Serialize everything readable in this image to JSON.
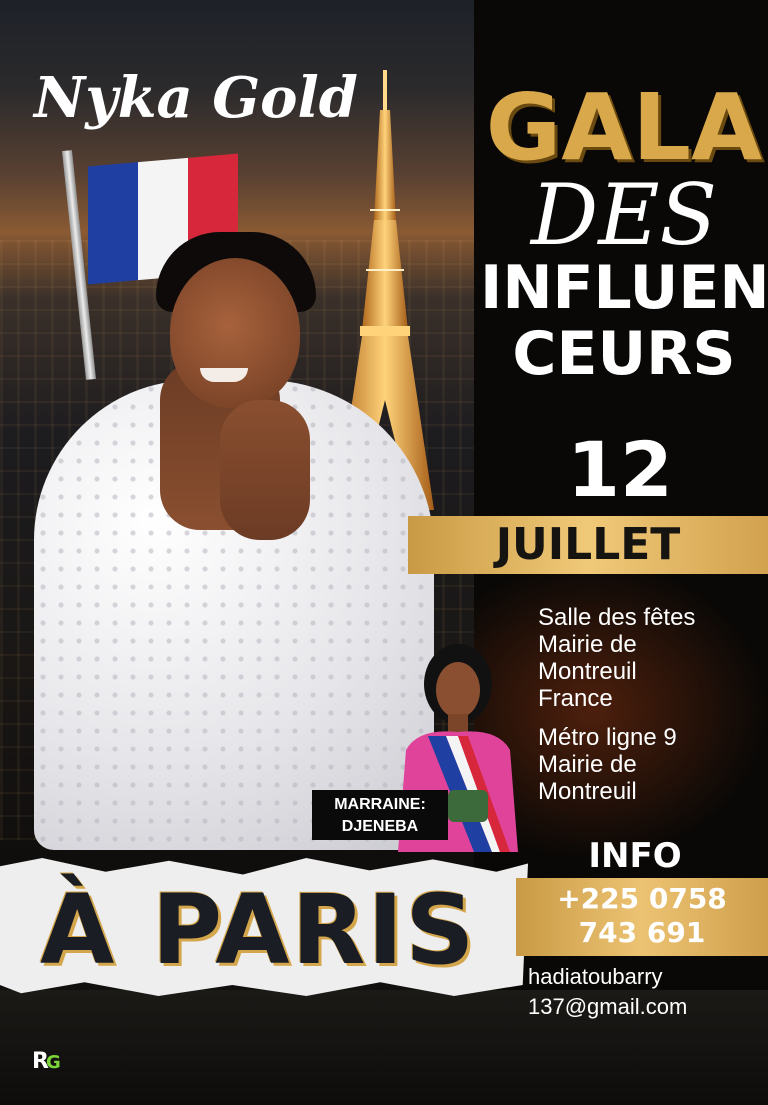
{
  "brand": "Nyka Gold",
  "title": {
    "line1": "GALA",
    "line2": "DES",
    "line3": "INFLUEN",
    "line4": "CEURS"
  },
  "date": {
    "day": "12",
    "month": "JUILLET"
  },
  "venue": {
    "line1": "Salle des fêtes",
    "line2": "Mairie de",
    "line3": "Montreuil",
    "line4": "France"
  },
  "metro": {
    "line1": "Métro ligne  9",
    "line2": "Mairie de",
    "line3": "Montreuil"
  },
  "marraine": {
    "label": "MARRAINE:",
    "name": "DJENEBA"
  },
  "info": {
    "title": "INFO",
    "phone_line1": "+225 0758",
    "phone_line2": "743 691",
    "email_line1": "hadiatoubarry",
    "email_line2": "137@gmail.com"
  },
  "city_banner": "À PARIS",
  "colors": {
    "gold": "#d9a84a",
    "gold_band": "#ecc373",
    "dark": "#0a0806",
    "white": "#ffffff",
    "flag_blue": "#1f3fa3",
    "flag_white": "#f4f4f4",
    "flag_red": "#d6283a"
  }
}
